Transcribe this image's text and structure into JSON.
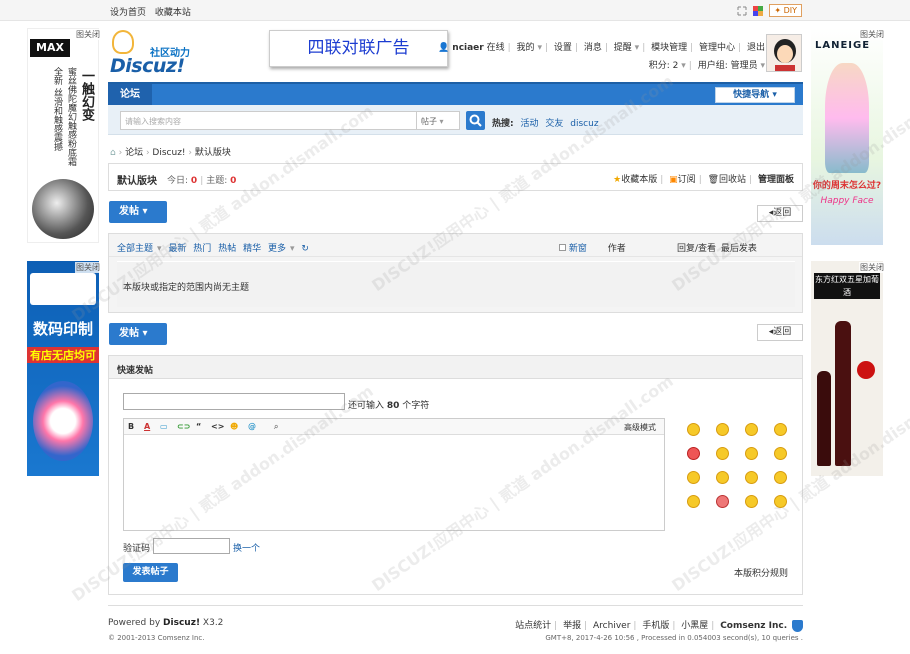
{
  "topbar": {
    "set_home": "设为首页",
    "bookmark": "收藏本站",
    "diy": "DIY"
  },
  "ads": {
    "close_label": "",
    "left_top": {
      "brand": "MAX",
      "line1": "一触幻变",
      "line2": "蜜丝佛陀魔幻触感粉底霜",
      "line3": "全新 丝滑和触感震撼"
    },
    "left_bottom": {
      "line1": "数码印制",
      "line2": "有店无店均可"
    },
    "right_top": {
      "brand": "LANEIGE",
      "line1": "你的周末怎么过?",
      "line2": "Happy Face"
    },
    "right_bottom": {
      "line1": "东方红双五星加葡酒"
    }
  },
  "logo": {
    "sub": "社区动力",
    "main": "Discuz!"
  },
  "banner_ad": "四联对联广告",
  "user": {
    "name": "nciaer",
    "status": "在线",
    "links": [
      "我的",
      "设置",
      "消息",
      "提醒",
      "模块管理",
      "管理中心",
      "退出"
    ],
    "credits": "积分: 2",
    "group": "用户组: 管理员"
  },
  "nav": {
    "forum_tab": "论坛",
    "quick_nav": "快捷导航"
  },
  "search": {
    "placeholder": "请输入搜索内容",
    "type": "帖子",
    "hot_label": "热搜:",
    "hot": [
      "活动",
      "交友",
      "discuz"
    ]
  },
  "breadcrumb": [
    "论坛",
    "Discuz!",
    "默认版块"
  ],
  "forum": {
    "name": "默认版块",
    "today_label": "今日:",
    "today": "0",
    "topics_label": "主题:",
    "topics": "0",
    "fav": "收藏本版",
    "rss": "订阅",
    "recycle": "回收站",
    "admin": "管理面板"
  },
  "post_button": "发帖",
  "back_button": "返回",
  "thread_list": {
    "filters": [
      "全部主题",
      "最新",
      "热门",
      "热帖",
      "精华",
      "更多"
    ],
    "new_label": "新窗",
    "author": "作者",
    "reply_view": "回复/查看",
    "last_post": "最后发表",
    "empty": "本版块或指定的范围内尚无主题"
  },
  "fast_post": {
    "title": "快速发帖",
    "limit_prefix": "还可输入",
    "limit": "80",
    "limit_suffix": "个字符",
    "advanced": "高级模式",
    "captcha_label": "验证码",
    "captcha_change": "换一个",
    "submit": "发表帖子",
    "rules": "本版积分规则"
  },
  "footer": {
    "powered_by": "Powered by",
    "brand": "Discuz!",
    "version": "X3.2",
    "copyright": "© 2001-2013 Comsenz Inc.",
    "links": [
      "站点统计",
      "举报",
      "Archiver",
      "手机版",
      "小黑屋"
    ],
    "company": "Comsenz Inc.",
    "stats": "GMT+8, 2017-4-26 10:56 , Processed in 0.054003 second(s), 10 queries ."
  },
  "watermark": "DISCUZ!应用中心 | 贰道 addon.dismall.com"
}
